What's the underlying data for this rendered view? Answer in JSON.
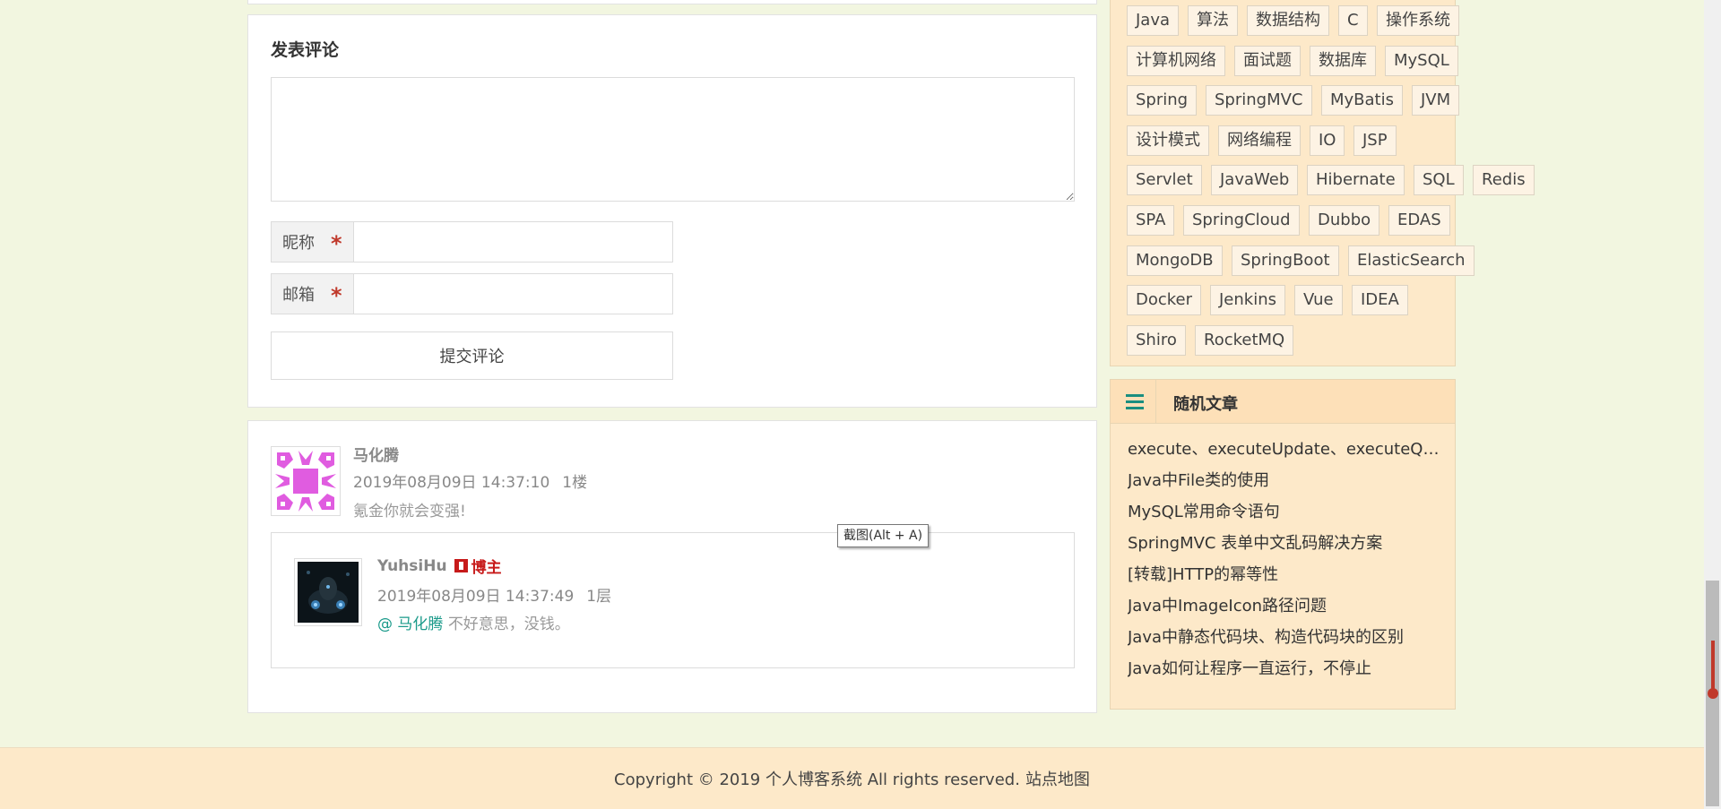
{
  "comment_form": {
    "title": "发表评论",
    "textarea_placeholder": "",
    "nickname_label": "昵称",
    "email_label": "邮箱",
    "required_mark": "*",
    "submit_label": "提交评论"
  },
  "comments": [
    {
      "author": "马化腾",
      "time": "2019年08月09日 14:37:10",
      "floor": "1楼",
      "text": "氪金你就会变强!",
      "replies": [
        {
          "author": "YuhsiHu",
          "badge": "博主",
          "time": "2019年08月09日 14:37:49",
          "floor": "1层",
          "mention": "@ 马化腾",
          "text": "不好意思，没钱。"
        }
      ]
    }
  ],
  "tooltip": "截图(Alt + A)",
  "tags": [
    "Java",
    "算法",
    "数据结构",
    "C",
    "操作系统",
    "计算机网络",
    "面试题",
    "数据库",
    "MySQL",
    "Spring",
    "SpringMVC",
    "MyBatis",
    "JVM",
    "设计模式",
    "网络编程",
    "IO",
    "JSP",
    "Servlet",
    "JavaWeb",
    "Hibernate",
    "SQL",
    "Redis",
    "SPA",
    "SpringCloud",
    "Dubbo",
    "EDAS",
    "MongoDB",
    "SpringBoot",
    "ElasticSearch",
    "Docker",
    "Jenkins",
    "Vue",
    "IDEA",
    "Shiro",
    "RocketMQ"
  ],
  "random_articles": {
    "title": "随机文章",
    "items": [
      "execute、executeUpdate、executeQuery三者的区别",
      "Java中File类的使用",
      "MySQL常用命令语句",
      "SpringMVC 表单中文乱码解决方案",
      "[转载]HTTP的幂等性",
      "Java中ImageIcon路径问题",
      "Java中静态代码块、构造代码块的区别",
      "Java如何让程序一直运行，不停止"
    ]
  },
  "footer": {
    "copyright": "Copyright © 2019 个人博客系统 All rights reserved.",
    "sitemap": "站点地图"
  },
  "colors": {
    "page_bg": "#f2f6e0",
    "sidebar_bg": "#fde9c9",
    "accent": "#1a8e80",
    "owner_badge": "#c71a1a"
  }
}
